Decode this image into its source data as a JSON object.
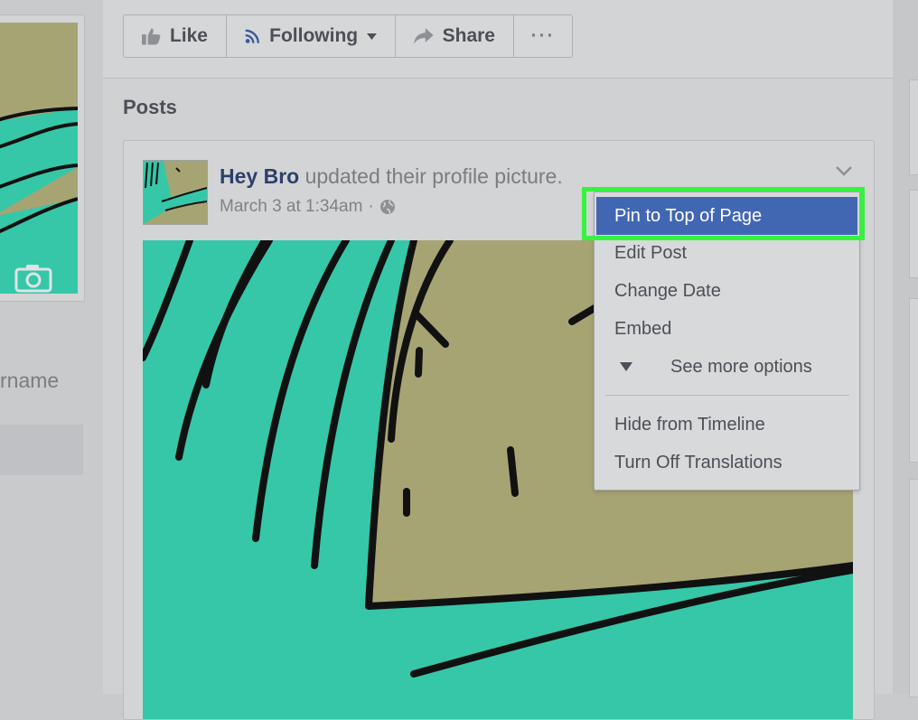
{
  "page_actions": {
    "like_label": "Like",
    "following_label": "Following",
    "share_label": "Share",
    "more_label": "···"
  },
  "left_column": {
    "username_fragment": "rname"
  },
  "posts_section": {
    "title": "Posts",
    "post": {
      "author": "Hey Bro",
      "action": "updated their profile picture.",
      "timestamp": "March 3 at 1:34am",
      "separator": "·",
      "privacy_icon": "globe-icon"
    }
  },
  "post_menu": {
    "items": [
      "Pin to Top of Page",
      "Edit Post",
      "Change Date",
      "Embed",
      "See more options",
      "Hide from Timeline",
      "Turn Off Translations"
    ],
    "highlighted": "Pin to Top of Page"
  },
  "colors": {
    "highlight": "#4267b2",
    "annotation_frame": "#35f33f",
    "author_link": "#2e3f6a",
    "illustration_teal": "#35c7a8",
    "illustration_olive": "#a6a473"
  }
}
